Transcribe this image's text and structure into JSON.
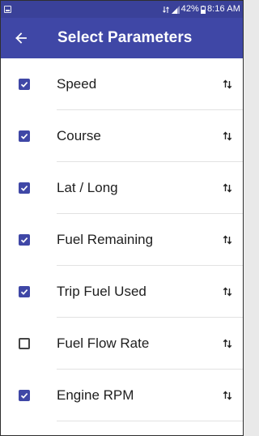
{
  "status_bar": {
    "battery": "42%",
    "time": "8:16 AM",
    "background": "#3a4199"
  },
  "app_bar": {
    "title": "Select Parameters",
    "back_icon": "arrow-left-icon",
    "background": "#3f47a6"
  },
  "parameters": [
    {
      "label": "Speed",
      "checked": true
    },
    {
      "label": "Course",
      "checked": true
    },
    {
      "label": "Lat / Long",
      "checked": true
    },
    {
      "label": "Fuel Remaining",
      "checked": true
    },
    {
      "label": "Trip Fuel Used",
      "checked": true
    },
    {
      "label": "Fuel Flow Rate",
      "checked": false
    },
    {
      "label": "Engine RPM",
      "checked": true
    }
  ],
  "reorder_icon": "swap-vert-icon",
  "accent_color": "#3f47a6"
}
